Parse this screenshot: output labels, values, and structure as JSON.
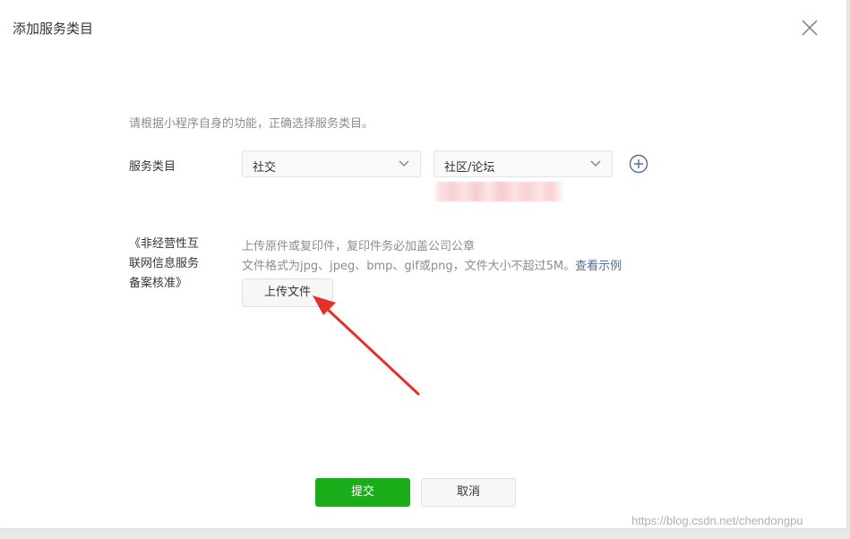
{
  "dialog": {
    "title": "添加服务类目",
    "close_icon": "close-icon"
  },
  "intro": "请根据小程序自身的功能，正确选择服务类目。",
  "category": {
    "label": "服务类目",
    "primary_select": {
      "value": "社交",
      "icon": "chevron-down-icon"
    },
    "secondary_select": {
      "value": "社区/论坛",
      "icon": "chevron-down-icon"
    },
    "add_icon": "plus-circle-icon"
  },
  "license": {
    "label_lines": [
      "《非经营性互",
      "联网信息服务",
      "备案核准》"
    ],
    "tip_line1": "上传原件或复印件，复印件务必加盖公司公章",
    "tip_line2": "文件格式为jpg、jpeg、bmp、gif或png，文件大小不超过5M。",
    "example_link": "查看示例",
    "upload_label": "上传文件"
  },
  "footer": {
    "submit_label": "提交",
    "cancel_label": "取消"
  },
  "watermark": "https://blog.csdn.net/chendongpu",
  "colors": {
    "primary_green": "#1aad19",
    "link_blue": "#576b95",
    "annotation_red": "#e8302a"
  }
}
